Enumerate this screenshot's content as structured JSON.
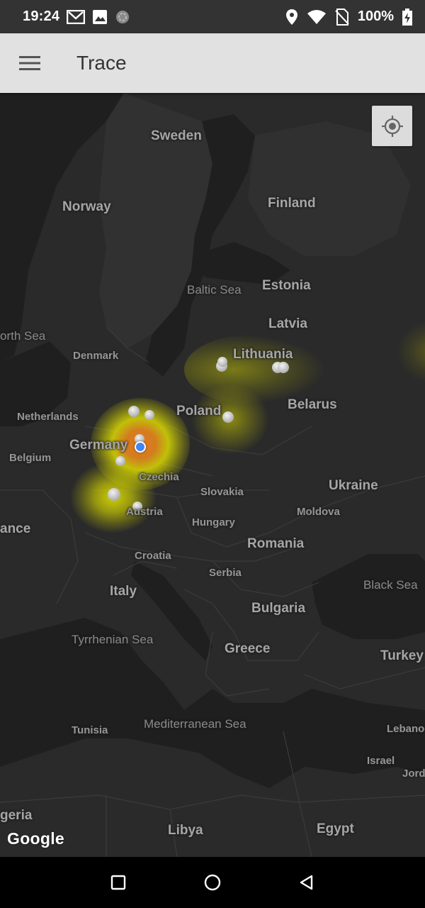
{
  "status_bar": {
    "time": "19:24",
    "battery": "100%",
    "left_icons": [
      "gmail-icon",
      "image-icon",
      "sync-icon"
    ],
    "right_icons": [
      "location-icon",
      "wifi-icon",
      "no-sim-icon",
      "battery-charging-icon"
    ]
  },
  "app_bar": {
    "title": "Trace",
    "menu_icon": "menu-icon"
  },
  "map": {
    "countries": {
      "sweden": "Sweden",
      "norway": "Norway",
      "finland": "Finland",
      "estonia": "Estonia",
      "latvia": "Latvia",
      "lithuania": "Lithuania",
      "poland": "Poland",
      "belarus": "Belarus",
      "germany": "Germany",
      "ukraine": "Ukraine",
      "romania": "Romania",
      "italy": "Italy",
      "bulgaria": "Bulgaria",
      "greece": "Greece",
      "turkey": "Turkey",
      "libya": "Libya",
      "egypt": "Egypt",
      "france_partial": "ance",
      "algeria_partial": "geria"
    },
    "small_labels": {
      "denmark": "Denmark",
      "netherlands": "Netherlands",
      "belgium": "Belgium",
      "czechia": "Czechia",
      "slovakia": "Slovakia",
      "austria": "Austria",
      "hungary": "Hungary",
      "moldova": "Moldova",
      "croatia": "Croatia",
      "serbia": "Serbia",
      "tunisia": "Tunisia",
      "israel": "Israel",
      "lebanon_partial": "Lebano",
      "jordan_partial": "Jord"
    },
    "seas": {
      "baltic": "Baltic Sea",
      "north_partial": "orth Sea",
      "black": "Black Sea",
      "tyrrhenian": "Tyrrhenian Sea",
      "mediterranean": "Mediterranean Sea"
    },
    "attribution": "Google",
    "locate_icon": "my-location-icon",
    "heatmap_colors": {
      "low": "#e6e600",
      "high": "#f07a1a"
    },
    "my_location_color": "#4285f4"
  },
  "nav_bar": {
    "buttons": [
      "recents-square-icon",
      "home-circle-icon",
      "back-triangle-icon"
    ]
  }
}
